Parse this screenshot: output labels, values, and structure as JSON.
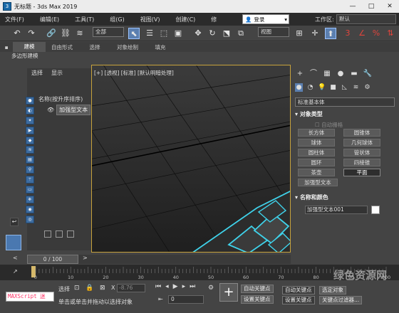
{
  "window": {
    "title": "无标题 - 3ds Max 2019",
    "minimize": "—",
    "maximize": "□",
    "close": "✕"
  },
  "menu": {
    "items": [
      "文件(F)",
      "编辑(E)",
      "工具(T)",
      "组(G)",
      "视图(V)",
      "创建(C)",
      "修"
    ]
  },
  "login": {
    "label": "登录",
    "icon": "user-icon"
  },
  "workspace": {
    "label": "工作区:",
    "value": "默认"
  },
  "toolbar": {
    "selection_filter": "全部",
    "view_select": "视图"
  },
  "ribbon": {
    "tabs": [
      "建模",
      "自由形式",
      "选择",
      "对象绘制",
      "填充"
    ],
    "active": "建模",
    "sub_label": "多边形建模"
  },
  "scene_explorer": {
    "tabs": [
      "选择",
      "显示"
    ],
    "column_header": "名称(按升序排序)",
    "objects": [
      {
        "name": "加强型文本",
        "visible_icon": "eye-icon"
      }
    ]
  },
  "viewport": {
    "label": "[+] [透视] [标准] [默认明暗处理]",
    "border_color": "#c7a23c",
    "text_outline_color": "#3fd2ea"
  },
  "command_panel": {
    "category": "标准基本体",
    "object_type_header": "对象类型",
    "autogrid": "自动栅格",
    "buttons": [
      "长方体",
      "圆锥体",
      "球体",
      "几何球体",
      "圆柱体",
      "管状体",
      "圆环",
      "四棱锥",
      "茶壶",
      "平面",
      "加强型文本"
    ],
    "active_button": "平面",
    "name_color_header": "名称和颜色",
    "object_name": "加强型文本001",
    "object_color": "#ffffff"
  },
  "timeline": {
    "position": "0 / 100",
    "prev": "<",
    "next": ">",
    "ticks": [
      "0",
      "10",
      "20",
      "30",
      "40",
      "50",
      "60",
      "70",
      "80",
      "90",
      "100"
    ]
  },
  "status": {
    "maxscript": "MAXScript 迷",
    "selection_label": "选择",
    "prompt": "单击或单击并拖动以选择对象",
    "coord": "-8.76",
    "frame": "0",
    "auto_key": "自动关键点",
    "set_key": "设置关键点",
    "selected_obj": "选定对象",
    "key_filter": "关键点过滤器..."
  },
  "watermark": "绿色资源网"
}
